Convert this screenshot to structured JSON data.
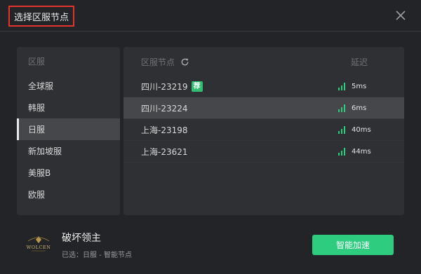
{
  "dialog": {
    "title": "选择区服节点"
  },
  "regions": {
    "header": "区服",
    "items": [
      {
        "label": "全球服",
        "active": false
      },
      {
        "label": "韩服",
        "active": false
      },
      {
        "label": "日服",
        "active": true
      },
      {
        "label": "新加坡服",
        "active": false
      },
      {
        "label": "美服B",
        "active": false
      },
      {
        "label": "欧服",
        "active": false
      }
    ]
  },
  "nodes": {
    "header": "区服节点",
    "latency_header": "延迟",
    "recommend_badge": "荐",
    "rows": [
      {
        "name": "四川-23219",
        "recommended": true,
        "latency": "5ms",
        "active": false
      },
      {
        "name": "四川-23224",
        "recommended": false,
        "latency": "6ms",
        "active": true
      },
      {
        "name": "上海-23198",
        "recommended": false,
        "latency": "40ms",
        "active": false
      },
      {
        "name": "上海-23621",
        "recommended": false,
        "latency": "44ms",
        "active": false
      }
    ]
  },
  "game": {
    "logo_text": "WOLCEN",
    "name": "破坏领主",
    "selected_info": "已选：日服 - 智能节点"
  },
  "actions": {
    "accelerate_label": "智能加速"
  },
  "colors": {
    "accent_green": "#2ecc7f",
    "title_highlight": "#e2332d"
  }
}
